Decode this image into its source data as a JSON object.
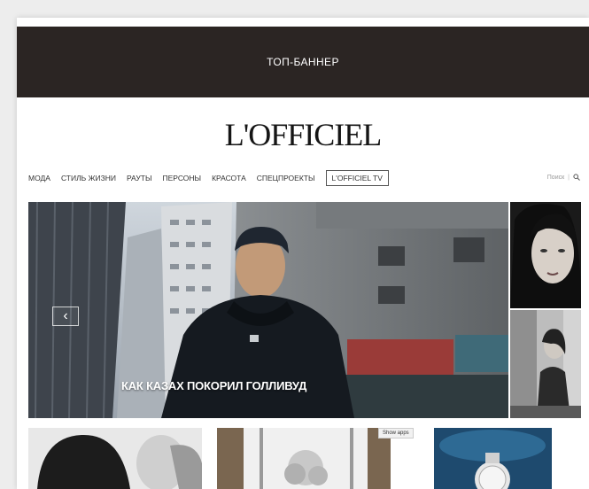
{
  "banner": {
    "text": "ТОП-БАННЕР"
  },
  "logo": {
    "text": "L'OFFICIEL"
  },
  "nav": {
    "items": [
      "МОДА",
      "СТИЛЬ ЖИЗНИ",
      "РАУТЫ",
      "ПЕРСОНЫ",
      "КРАСОТА",
      "СПЕЦПРОЕКТЫ",
      "L'OFFICIEL TV"
    ]
  },
  "search": {
    "label": "Поиск",
    "separator": "|",
    "icon": "search-icon"
  },
  "hero": {
    "caption": "КАК КАЗАХ ПОКОРИЛ ГОЛЛИВУД",
    "prev_icon": "‹"
  },
  "tooltip": {
    "text": "Show apps"
  },
  "colors": {
    "banner_bg": "#2b2523",
    "banner_text": "#ffffff",
    "page_bg": "#ffffff"
  }
}
